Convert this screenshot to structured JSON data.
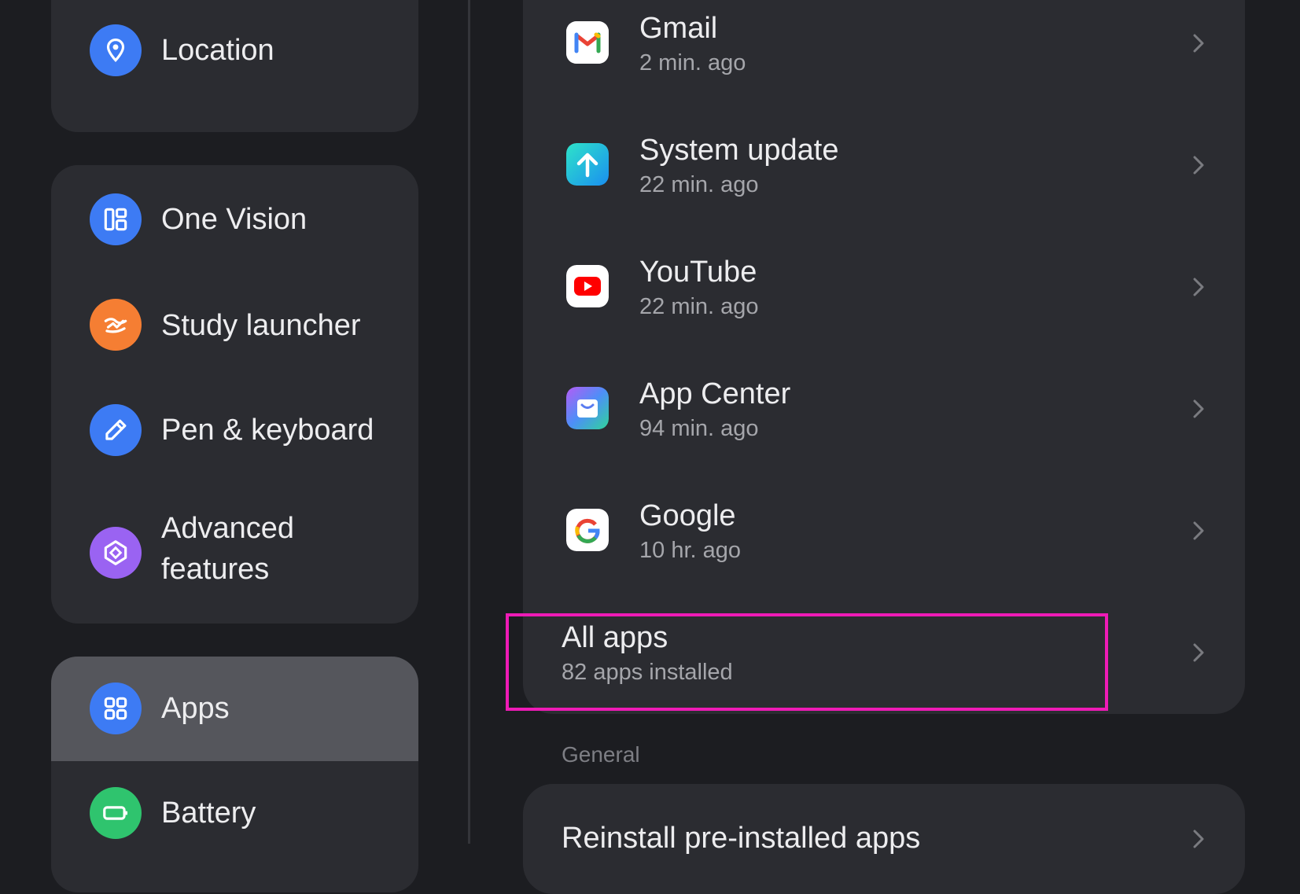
{
  "sidebar": {
    "cards": [
      {
        "items": [
          {
            "label": "Location",
            "icon": "location-pin-icon",
            "color": "#3d7bf4"
          }
        ]
      },
      {
        "items": [
          {
            "label": "One Vision",
            "icon": "one-vision-icon",
            "color": "#3d7bf4"
          },
          {
            "label": "Study launcher",
            "icon": "study-launcher-icon",
            "color": "#f57e33"
          },
          {
            "label": "Pen & keyboard",
            "icon": "pen-icon",
            "color": "#3d7bf4"
          },
          {
            "label_line1": "Advanced",
            "label_line2": "features",
            "icon": "advanced-features-icon",
            "color": "#9a63f2"
          }
        ]
      },
      {
        "items": [
          {
            "label": "Apps",
            "icon": "apps-grid-icon",
            "color": "#3d7bf4",
            "selected": true
          },
          {
            "label": "Battery",
            "icon": "battery-icon",
            "color": "#2fc46e"
          }
        ]
      }
    ]
  },
  "recent_apps": [
    {
      "name": "Gmail",
      "time": "2 min. ago",
      "icon": "gmail-icon"
    },
    {
      "name": "System update",
      "time": "22 min. ago",
      "icon": "system-update-icon"
    },
    {
      "name": "YouTube",
      "time": "22 min. ago",
      "icon": "youtube-icon"
    },
    {
      "name": "App Center",
      "time": "94 min. ago",
      "icon": "app-center-icon"
    },
    {
      "name": "Google",
      "time": "10 hr. ago",
      "icon": "google-icon"
    }
  ],
  "all_apps": {
    "title": "All apps",
    "subtitle": "82 apps installed"
  },
  "general": {
    "header": "General",
    "items": [
      {
        "label": "Reinstall pre-installed apps"
      }
    ]
  },
  "colors": {
    "background": "#1c1d21",
    "card": "#2b2c31",
    "selected": "#55565c",
    "highlight": "#ee1bb6"
  }
}
